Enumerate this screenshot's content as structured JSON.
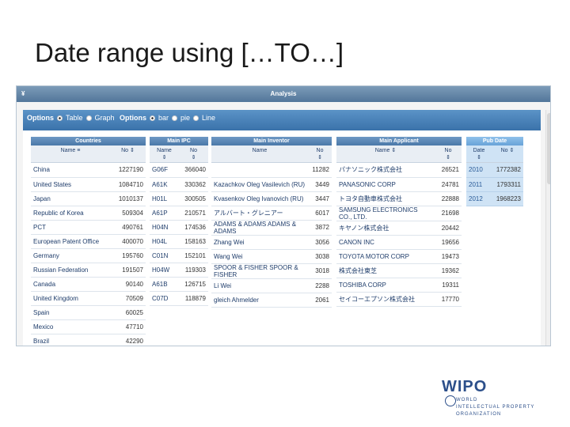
{
  "slide": {
    "title": "Date range using […TO…]"
  },
  "app": {
    "title": "Analysis",
    "collapse_glyph": "¥"
  },
  "options": {
    "group1_label": "Options",
    "table": "Table",
    "graph": "Graph",
    "group2_label": "Options",
    "bar": "bar",
    "pie": "pie",
    "line": "Line"
  },
  "countries": {
    "header": "Countries",
    "col_name": "Name",
    "col_no": "No",
    "rows": [
      {
        "name": "China",
        "no": "1227190"
      },
      {
        "name": "United States",
        "no": "1084710"
      },
      {
        "name": "Japan",
        "no": "1010137"
      },
      {
        "name": "Republic of Korea",
        "no": "509304"
      },
      {
        "name": "PCT",
        "no": "490761"
      },
      {
        "name": "European Patent Office",
        "no": "400070"
      },
      {
        "name": "Germany",
        "no": "195760"
      },
      {
        "name": "Russian Federation",
        "no": "191507"
      },
      {
        "name": "Canada",
        "no": "90140"
      },
      {
        "name": "United Kingdom",
        "no": "70509"
      },
      {
        "name": "Spain",
        "no": "60025"
      },
      {
        "name": "Mexico",
        "no": "47710"
      },
      {
        "name": "Brazil",
        "no": "42290"
      }
    ]
  },
  "ipc": {
    "header": "Main IPC",
    "col_name": "Name",
    "col_no": "No",
    "rows": [
      {
        "name": "G06F",
        "no": "366040"
      },
      {
        "name": "A61K",
        "no": "330362"
      },
      {
        "name": "H01L",
        "no": "300505"
      },
      {
        "name": "A61P",
        "no": "210571"
      },
      {
        "name": "H04N",
        "no": "174536"
      },
      {
        "name": "H04L",
        "no": "158163"
      },
      {
        "name": "C01N",
        "no": "152101"
      },
      {
        "name": "H04W",
        "no": "119303"
      },
      {
        "name": "A61B",
        "no": "126715"
      },
      {
        "name": "C07D",
        "no": "118879"
      }
    ]
  },
  "inventor": {
    "header": "Main Inventor",
    "col_name": "Name",
    "col_no": "No",
    "rows": [
      {
        "name": "",
        "no": "11282"
      },
      {
        "name": "Kazachkov Oleg Vasilevich (RU)",
        "no": "3449"
      },
      {
        "name": "Kvasenkov Oleg Ivanovich (RU)",
        "no": "3447"
      },
      {
        "name": "アルバート・グレニアー",
        "no": "6017"
      },
      {
        "name": "ADAMS & ADAMS ADAMS & ADAMS",
        "no": "3872"
      },
      {
        "name": "Zhang Wei",
        "no": "3056"
      },
      {
        "name": "Wang Wei",
        "no": "3038"
      },
      {
        "name": "SPOOR & FISHER SPOOR & FISHER",
        "no": "3018"
      },
      {
        "name": "Li Wei",
        "no": "2288"
      },
      {
        "name": "gleich Ahmelder",
        "no": "2061"
      }
    ]
  },
  "applicant": {
    "header": "Main Applicant",
    "col_name": "Name",
    "col_no": "No",
    "rows": [
      {
        "name": "パナソニック株式会社",
        "no": "26521"
      },
      {
        "name": "PANASONIC CORP",
        "no": "24781"
      },
      {
        "name": "トヨタ自動車株式会社",
        "no": "22888"
      },
      {
        "name": "SAMSUNG ELECTRONICS CO., LTD.",
        "no": "21698"
      },
      {
        "name": "キヤノン株式会社",
        "no": "20442"
      },
      {
        "name": "CANON INC",
        "no": "19656"
      },
      {
        "name": "TOYOTA MOTOR CORP",
        "no": "19473"
      },
      {
        "name": "株式会社東芝",
        "no": "19362"
      },
      {
        "name": "TOSHIBA CORP",
        "no": "19311"
      },
      {
        "name": "セイコーエプソン株式会社",
        "no": "17770"
      }
    ]
  },
  "pubdate": {
    "header": "Pub Date",
    "col_date": "Date",
    "col_no": "No",
    "rows": [
      {
        "date": "2010",
        "no": "1772382"
      },
      {
        "date": "2011",
        "no": "1793311"
      },
      {
        "date": "2012",
        "no": "1968223"
      }
    ]
  },
  "logo": {
    "mark": "WIPO",
    "line1": "WORLD",
    "line2": "INTELLECTUAL PROPERTY",
    "line3": "ORGANIZATION"
  },
  "colors": {
    "accent": "#4a78a8",
    "selected": "#cfe3f5",
    "logo": "#2c4f8a"
  }
}
